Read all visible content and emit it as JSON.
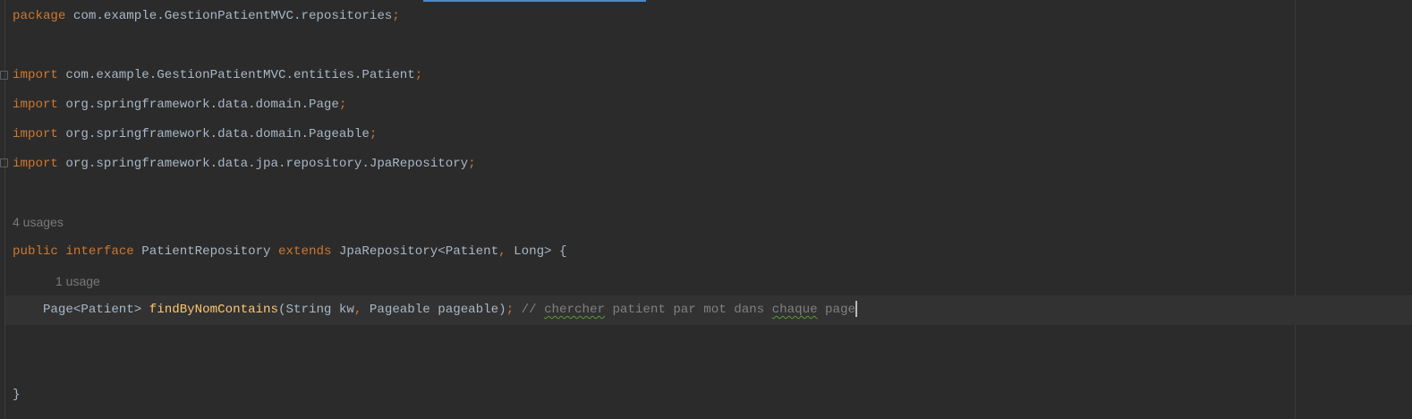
{
  "colors": {
    "background": "#2b2b2b",
    "keyword": "#cc7832",
    "identifier": "#a9b7c6",
    "method": "#ffc66d",
    "comment": "#808080"
  },
  "code": {
    "l1": {
      "kw": "package",
      "rest": " com.example.GestionPatientMVC.repositories",
      "semi": ";"
    },
    "l3": {
      "kw": "import",
      "rest": " com.example.GestionPatientMVC.entities.Patient",
      "semi": ";"
    },
    "l4": {
      "kw": "import",
      "rest": " org.springframework.data.domain.Page",
      "semi": ";"
    },
    "l5": {
      "kw": "import",
      "rest": " org.springframework.data.domain.Pageable",
      "semi": ";"
    },
    "l6": {
      "kw": "import",
      "rest": " org.springframework.data.jpa.repository.JpaRepository",
      "semi": ";"
    },
    "usages_interface": "4 usages",
    "l8": {
      "kw1": "public",
      "kw2": "interface",
      "name": " PatientRepository ",
      "kw3": "extends",
      "type": " JpaRepository<Patient",
      "comma": ",",
      "rest": " Long> {"
    },
    "usages_method": "1 usage",
    "l9": {
      "ret": "    Page<Patient> ",
      "method": "findByNomContains",
      "params1": "(String kw",
      "comma": ",",
      "params2": " Pageable pageable)",
      "semi": ";",
      "cm_prefix": " // ",
      "cm_w1": "chercher",
      "cm_mid": " patient par mot dans ",
      "cm_w2": "chaque",
      "cm_end": " page"
    },
    "l12": "}"
  }
}
